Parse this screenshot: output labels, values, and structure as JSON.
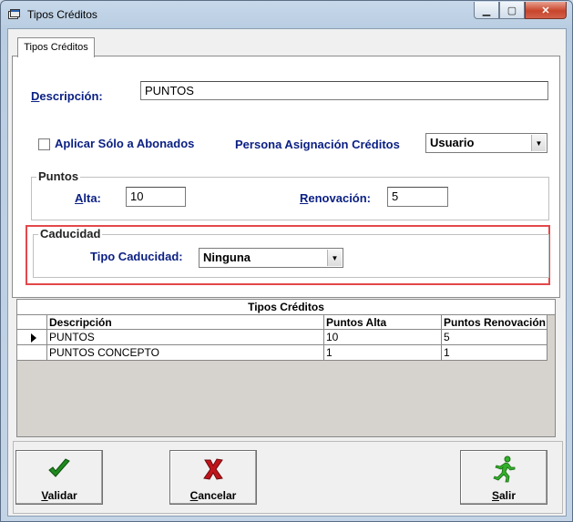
{
  "window": {
    "title": "Tipos Créditos"
  },
  "tab": {
    "label": "Tipos Créditos"
  },
  "form": {
    "descripcion_prefix": "D",
    "descripcion_rest": "escripción:",
    "descripcion_value": "PUNTOS",
    "aplicar_label": "Aplicar Sólo a Abonados",
    "persona_label": "Persona Asignación Créditos",
    "persona_value": "Usuario",
    "puntos_group": "Puntos",
    "alta_prefix": "A",
    "alta_rest": "lta:",
    "alta_value": "10",
    "renov_prefix": "R",
    "renov_rest": "enovación:",
    "renov_value": "5",
    "caducidad_group": "Caducidad",
    "tipo_caducidad_label": "Tipo Caducidad:",
    "tipo_caducidad_value": "Ninguna"
  },
  "grid": {
    "title": "Tipos Créditos",
    "columns": [
      "Descripción",
      "Puntos Alta",
      "Puntos Renovación"
    ],
    "rows": [
      [
        "PUNTOS",
        "10",
        "5"
      ],
      [
        "PUNTOS CONCEPTO",
        "1",
        "1"
      ]
    ]
  },
  "buttons": {
    "validar_prefix": "V",
    "validar_rest": "alidar",
    "cancelar_prefix": "C",
    "cancelar_rest": "ancelar",
    "salir_prefix": "S",
    "salir_rest": "alir"
  },
  "icons": {
    "validar": "check-icon",
    "cancelar": "red-x-icon",
    "salir": "running-man-icon"
  },
  "colors": {
    "label": "#0a1f83",
    "highlight": "#e3484a",
    "check": "#1f8a1f",
    "cancel": "#c0141a",
    "exit": "#33b02b"
  }
}
